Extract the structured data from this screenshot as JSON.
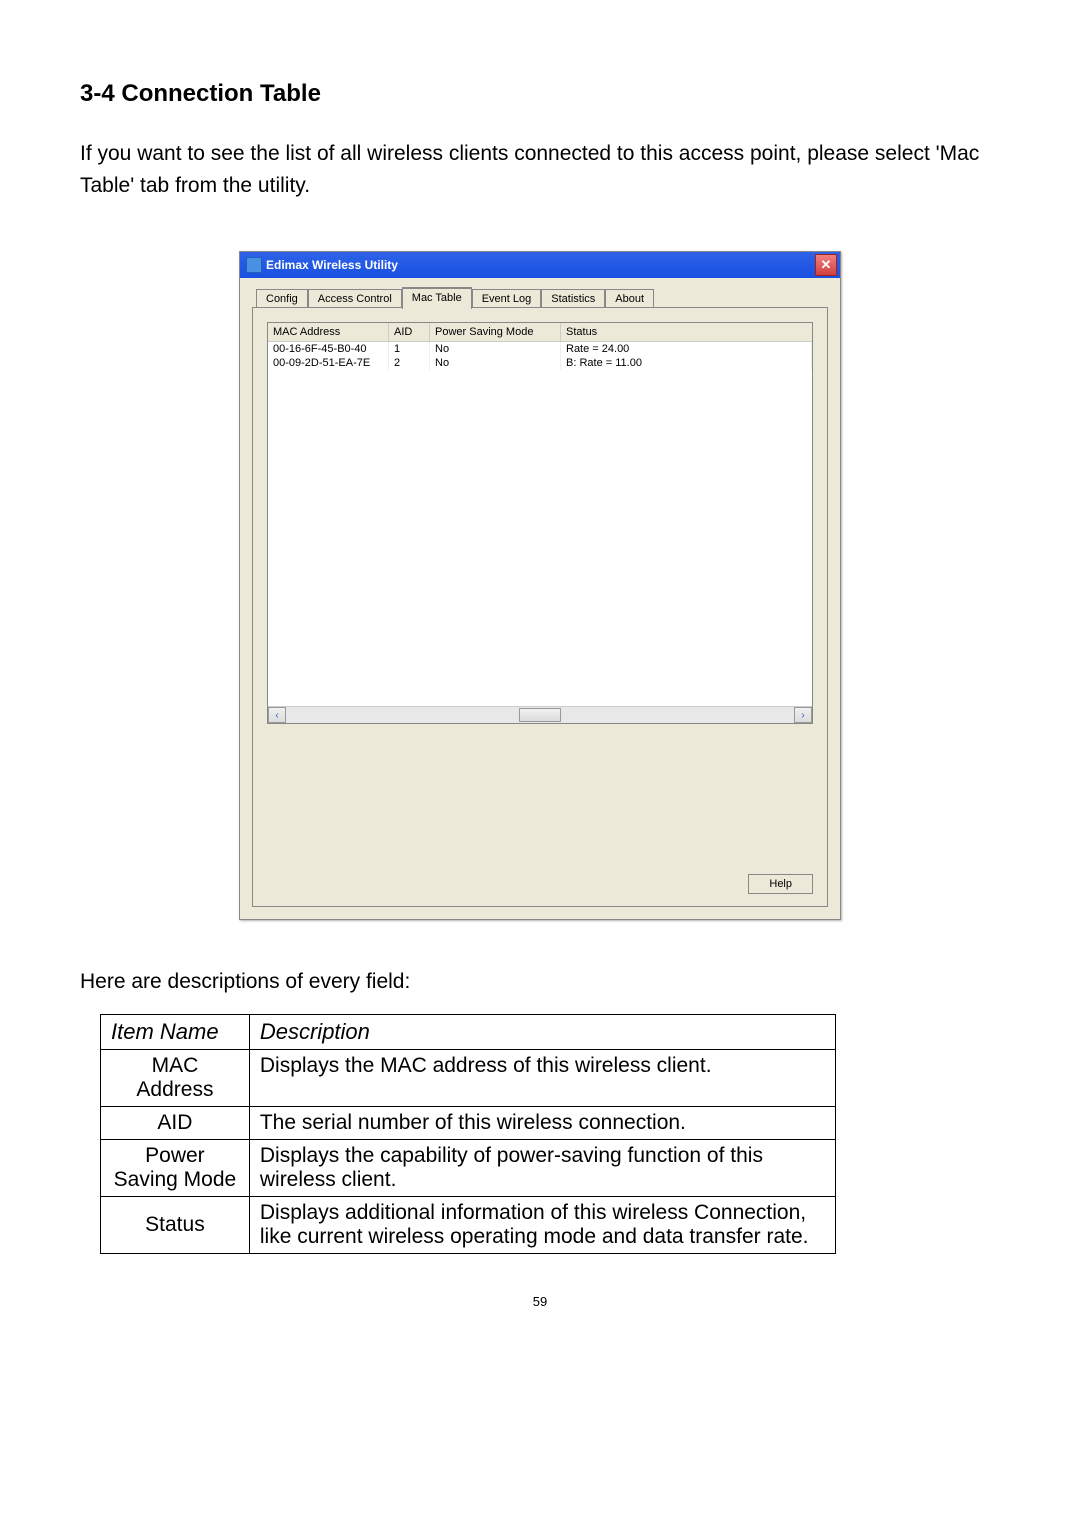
{
  "heading": "3-4 Connection Table",
  "intro": "If you want to see the list of all wireless clients connected to this access point, please select 'Mac Table' tab from the utility.",
  "app": {
    "title": "Edimax Wireless Utility",
    "close": "✕",
    "tabs": [
      "Config",
      "Access Control",
      "Mac Table",
      "Event Log",
      "Statistics",
      "About"
    ],
    "active_tab": "Mac Table",
    "columns": {
      "mac": "MAC Address",
      "aid": "AID",
      "psm": "Power Saving Mode",
      "status": "Status"
    },
    "rows": [
      {
        "mac": "00-16-6F-45-B0-40",
        "aid": "1",
        "psm": "No",
        "status": "Rate = 24.00"
      },
      {
        "mac": "00-09-2D-51-EA-7E",
        "aid": "2",
        "psm": "No",
        "status": "B: Rate = 11.00"
      }
    ],
    "help": "Help"
  },
  "descs_intro": "Here are descriptions of every field:",
  "desc_table": {
    "headers": {
      "item": "Item Name",
      "desc": "Description"
    },
    "rows": [
      {
        "item": "MAC Address",
        "desc": "Displays the MAC address of this wireless client."
      },
      {
        "item": "AID",
        "desc": "The serial number of this wireless connection."
      },
      {
        "item": "Power Saving Mode",
        "desc": "Displays the capability of power-saving function of this wireless client."
      },
      {
        "item": "Status",
        "desc": "Displays additional information of this wireless Connection, like current wireless operating mode and data transfer rate."
      }
    ]
  },
  "page_number": "59"
}
